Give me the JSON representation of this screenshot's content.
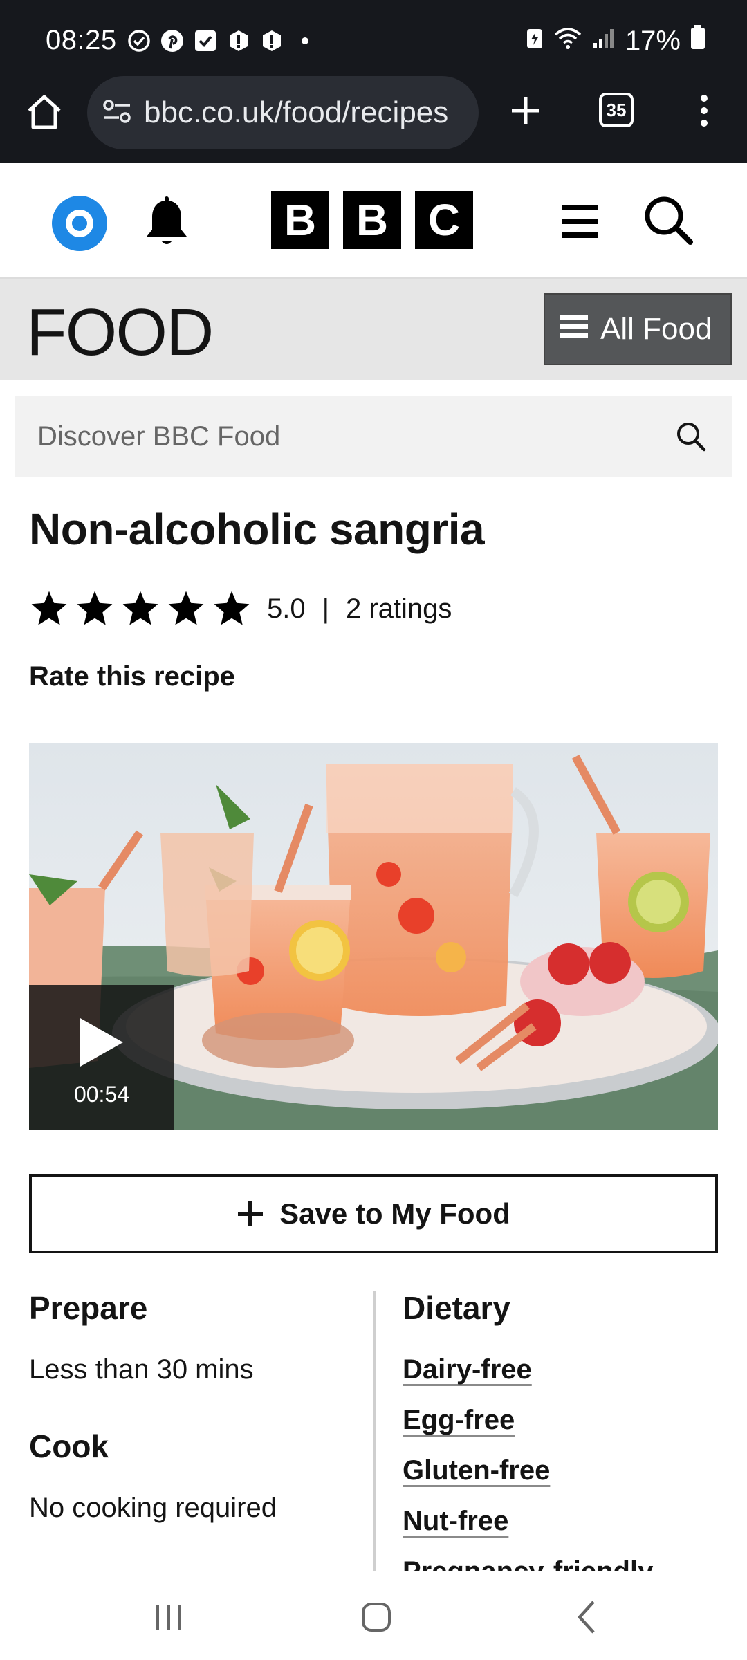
{
  "status_bar": {
    "time": "08:25",
    "battery": "17%",
    "notification_icons": [
      "check-circle-icon",
      "pinterest-icon",
      "checkbox-icon",
      "alert-icon",
      "alert-icon",
      "dot-icon"
    ]
  },
  "browser": {
    "url": "bbc.co.uk/food/recipes",
    "tab_count": "35"
  },
  "header": {
    "logo_letters": [
      "B",
      "B",
      "C"
    ]
  },
  "food_bar": {
    "title": "FOOD",
    "all_food_label": "All Food"
  },
  "search": {
    "placeholder": "Discover BBC Food"
  },
  "recipe": {
    "title": "Non-alcoholic sangria",
    "rating_value": "5.0",
    "separator": "|",
    "rating_count": "2 ratings",
    "stars": 5,
    "rate_label": "Rate this recipe",
    "video_duration": "00:54",
    "save_label": "Save to My Food"
  },
  "details": {
    "prepare_heading": "Prepare",
    "prepare_value": "Less than 30 mins",
    "cook_heading": "Cook",
    "cook_value": "No cooking required",
    "dietary_heading": "Dietary",
    "dietary_items": [
      "Dairy-free",
      "Egg-free",
      "Gluten-free",
      "Nut-free",
      "Pregnancy-friendly"
    ]
  },
  "colors": {
    "status_bg": "#16181d",
    "account_blue": "#1e88e5",
    "food_bar_bg": "#e6e6e6",
    "all_food_bg": "#545658"
  }
}
